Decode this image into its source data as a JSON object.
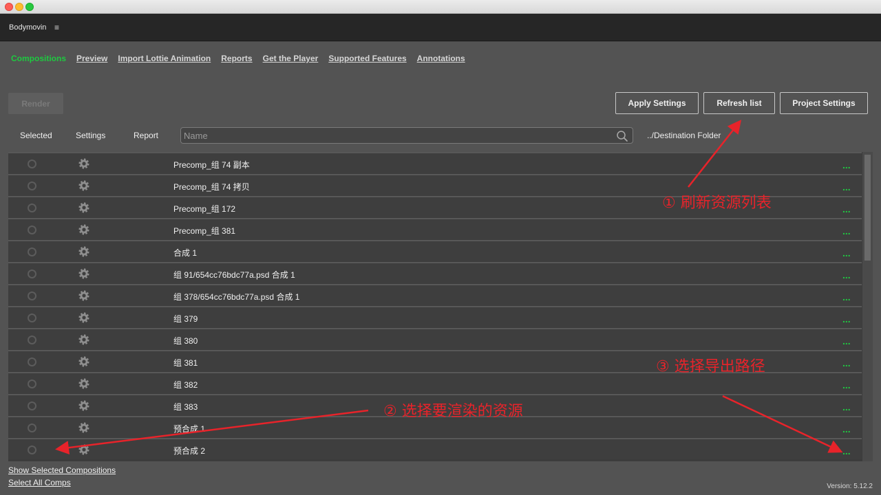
{
  "panel": {
    "title": "Bodymovin",
    "menu_icon": "≡"
  },
  "nav": [
    {
      "label": "Compositions",
      "active": true
    },
    {
      "label": "Preview"
    },
    {
      "label": "Import Lottie Animation"
    },
    {
      "label": "Reports"
    },
    {
      "label": "Get the Player"
    },
    {
      "label": "Supported Features"
    },
    {
      "label": "Annotations"
    }
  ],
  "buttons": {
    "render": "Render",
    "apply": "Apply Settings",
    "refresh": "Refresh list",
    "project": "Project Settings"
  },
  "columns": {
    "selected": "Selected",
    "settings": "Settings",
    "report": "Report",
    "destination": "../Destination Folder"
  },
  "search": {
    "placeholder": "Name"
  },
  "rows": [
    {
      "name": "Precomp_组 74 副本"
    },
    {
      "name": "Precomp_组 74 拷贝"
    },
    {
      "name": "Precomp_组 172"
    },
    {
      "name": "Precomp_组 381"
    },
    {
      "name": "合成 1"
    },
    {
      "name": "组 91/654cc76bdc77a.psd 合成 1"
    },
    {
      "name": "组 378/654cc76bdc77a.psd 合成 1"
    },
    {
      "name": "组 379"
    },
    {
      "name": "组 380"
    },
    {
      "name": "组 381"
    },
    {
      "name": "组 382"
    },
    {
      "name": "组 383"
    },
    {
      "name": "预合成 1"
    },
    {
      "name": "预合成 2"
    }
  ],
  "row_action": "...",
  "footer": {
    "show_selected": "Show Selected Compositions",
    "select_all": "Select All Comps",
    "version": "Version: 5.12.2"
  },
  "annotations": {
    "a1": "① 刷新资源列表",
    "a2": "② 选择要渲染的资源",
    "a3": "③ 选择导出路径"
  },
  "colors": {
    "accent_green": "#1ec940",
    "annotation_red": "#e8232a"
  }
}
